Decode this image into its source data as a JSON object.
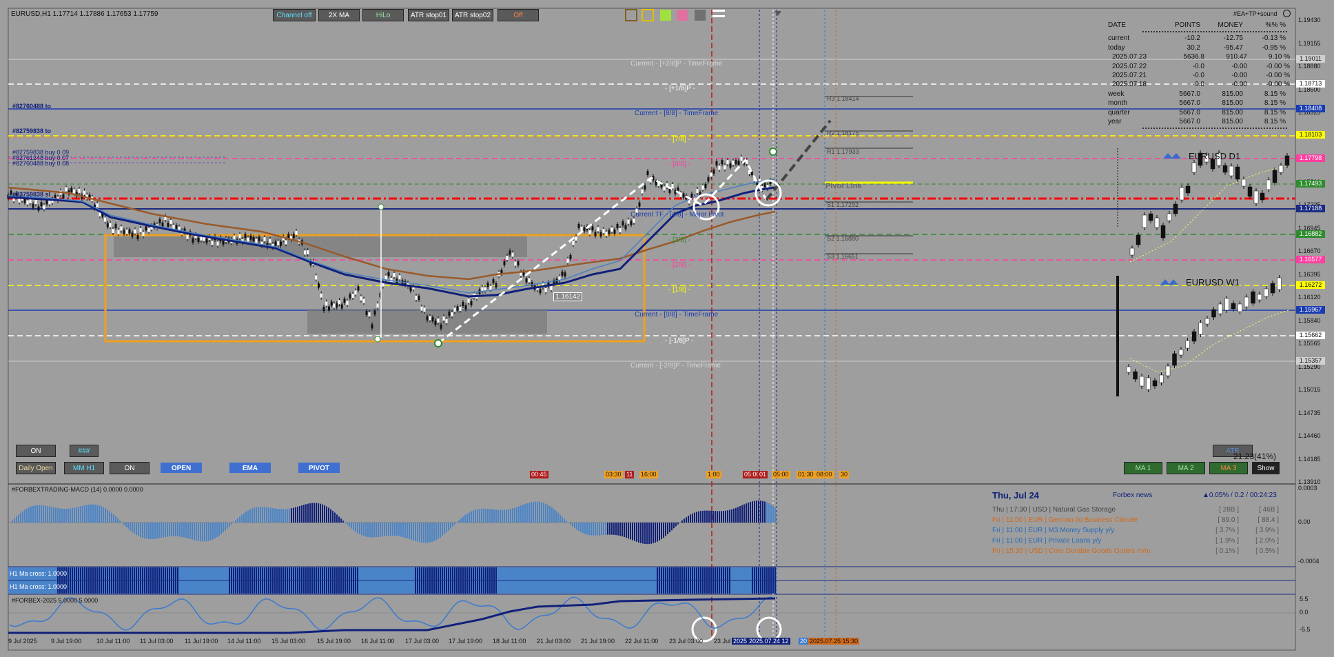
{
  "window": {
    "symbol_line": "EURUSD,H1  1.17714 1.17886 1.17653 1.17759",
    "top_right_label": "#EA+TP+sound"
  },
  "toolbar_top": {
    "buttons": [
      "Channel off",
      "2X MA",
      "HiLo",
      "ATR stop01",
      "ATR stop02",
      "Off"
    ]
  },
  "toolbar_bottom": {
    "on1": "ON",
    "hash": "###",
    "daily_open": "Daily Open",
    "mm_h1": "MM H1",
    "on2": "ON",
    "open": "OPEN",
    "ema": "EMA",
    "pivot": "PIVOT"
  },
  "right_buttons": {
    "ma1": "MA 1",
    "ma2": "MA 2",
    "ma3": "MA 3",
    "show": "Show",
    "atr": "ATR",
    "atr_value": "21.23(41%)"
  },
  "stats_table": {
    "headers": [
      "DATE",
      "POINTS",
      "MONEY",
      "%%  %"
    ],
    "rows": [
      [
        "current",
        "-10.2",
        "-12.75",
        "-0.13  %"
      ],
      [
        "today",
        "30.2",
        "-95.47",
        "-0.95  %"
      ],
      [
        "2025.07.23",
        "5636.8",
        "910.47",
        "9.10  %"
      ],
      [
        "2025.07.22",
        "-0.0",
        "-0.00",
        "-0.00  %"
      ],
      [
        "2025.07.21",
        "-0.0",
        "-0.00",
        "-0.00  %"
      ],
      [
        "2025.07.18",
        "-0.0",
        "-0.00",
        "-0.00  %"
      ],
      [
        "week",
        "5667.0",
        "815.00",
        "8.15  %"
      ],
      [
        "month",
        "5667.0",
        "815.00",
        "8.15  %"
      ],
      [
        "quarter",
        "5667.0",
        "815.00",
        "8.15  %"
      ],
      [
        "year",
        "5667.0",
        "815.00",
        "8.15  %"
      ]
    ]
  },
  "mini_charts": {
    "d1_label": "EURUSD D1",
    "w1_label": "EURUSD W1"
  },
  "trade_labels": {
    "t1": "#82760488 to",
    "t2": "#82759838 to",
    "t3": "#82759838 buy 0.09",
    "t4": "#82761248 buy 0.07",
    "t5": "#82760488 buy 0.08",
    "t6": "#82759838 sl"
  },
  "murrey_labels": {
    "p2_8": "Current - [+2/8]P - TimeFrame",
    "p1_8": "- [+1/8]P -",
    "l8_8": "Current - [8/8] - TimeFrame",
    "l7_8": "- [7/8] -",
    "l6_8": "- [6/8] -",
    "l4_8": "Current TF - [4/8] - Major Pivot",
    "l3_8": "- [3/8] -",
    "l2_8": "- [2/8] -",
    "l1_8": "- [1/8] -",
    "l0_8": "Current - [0/8] - TimeFrame",
    "m1_8": "- [-1/8]P -",
    "m2_8": "Current - [-2/8]P - TimeFrame",
    "price_tag": "1.16142"
  },
  "pivots": {
    "r3": "R3 1.18414",
    "r2": "R2 1.18175",
    "r1": "R1 1.17933",
    "pivot": "Pivot Line",
    "s1": "S1 1.17292",
    "s2": "S2 1.16880",
    "s3": "S3 1.16651"
  },
  "price_axis": {
    "ticks": [
      "1.19430",
      "1.19155",
      "1.18880",
      "1.18600",
      "1.18325",
      "1.18050",
      "1.17775",
      "1.17500",
      "1.17225",
      "1.16945",
      "1.16670",
      "1.16395",
      "1.16120",
      "1.15840",
      "1.15565",
      "1.15290",
      "1.15015",
      "1.14735",
      "1.14460",
      "1.14185",
      "1.13910"
    ],
    "tags": [
      {
        "text": "1.19011",
        "color": "#d0d0d0"
      },
      {
        "text": "1.18713",
        "color": "#ffffff"
      },
      {
        "text": "1.18408",
        "color": "#1a3cb0"
      },
      {
        "text": "1.18103",
        "color": "#ffff00"
      },
      {
        "text": "1.17798",
        "color": "#ff3fa0"
      },
      {
        "text": "1.17493",
        "color": "#2e8b2e"
      },
      {
        "text": "1.17188",
        "color": "#1a2a80"
      },
      {
        "text": "1.16882",
        "color": "#2e8b2e"
      },
      {
        "text": "1.16577",
        "color": "#ff3fa0"
      },
      {
        "text": "1.16272",
        "color": "#ffff00"
      },
      {
        "text": "1.15967",
        "color": "#1a3cb0"
      },
      {
        "text": "1.15662",
        "color": "#ffffff"
      },
      {
        "text": "1.15357",
        "color": "#d0d0d0"
      }
    ]
  },
  "time_axis": [
    "9 Jul 2025",
    "9 Jul 19:00",
    "10 Jul 11:00",
    "11 Jul 03:00",
    "11 Jul 19:00",
    "14 Jul 11:00",
    "15 Jul 03:00",
    "15 Jul 19:00",
    "16 Jul 11:00",
    "17 Jul 03:00",
    "17 Jul 19:00",
    "18 Jul 11:00",
    "21 Jul 03:00",
    "21 Jul 19:00",
    "22 Jul 11:00",
    "23 Jul 03:00",
    "23 Jul",
    "2025",
    "2025.07.24 12",
    "20",
    "2025.07.25 15:30"
  ],
  "event_tags": [
    "00:45",
    "03:30",
    "11",
    "16:00",
    "1:00",
    "05:00",
    "01",
    "05:00",
    "01:30",
    "08:00",
    "30"
  ],
  "macd": {
    "label": "#FORBEXTRADING-MACD (14) 0.0000 0.0000",
    "axis": [
      "0.0003",
      "0.00",
      "-0.0004"
    ]
  },
  "ma_cross": {
    "row1": "H1 Ma cross: 1.0000",
    "row2": "H1 Ma cross: 1.0000"
  },
  "forbex": {
    "label": "#FORBEX-2025 5.0000 5.0000",
    "axis": [
      "5.5",
      "0.0",
      "-5.5"
    ]
  },
  "news": {
    "date": "Thu, Jul 24",
    "source": "Forbex news",
    "stats": "0.05% / 0.2 / 00:24:23",
    "rows": [
      {
        "text": "Thu  |  17:30  |  USD  |  Natural Gas Storage",
        "a": "[ 28B ]",
        "b": "[ 46B ]",
        "color": "#444444"
      },
      {
        "text": "Fri  |  11:00  |  EUR  |  German ifo Business Climate",
        "a": "[ 89.0 ]",
        "b": "[ 88.4 ]",
        "color": "#d26a1a"
      },
      {
        "text": "Fri  |  11:00  |  EUR  |  M3 Money Supply y/y",
        "a": "[ 3.7% ]",
        "b": "[ 3.9% ]",
        "color": "#2a6ab8"
      },
      {
        "text": "Fri  |  11:00  |  EUR  |  Private Loans y/y",
        "a": "[ 1.9% ]",
        "b": "[ 2.0% ]",
        "color": "#2a6ab8"
      },
      {
        "text": "Fri  |  15:30  |  USD  |  Core Durable Goods Orders m/m",
        "a": "[ 0.1% ]",
        "b": "[ 0.5% ]",
        "color": "#d26a1a"
      }
    ]
  }
}
